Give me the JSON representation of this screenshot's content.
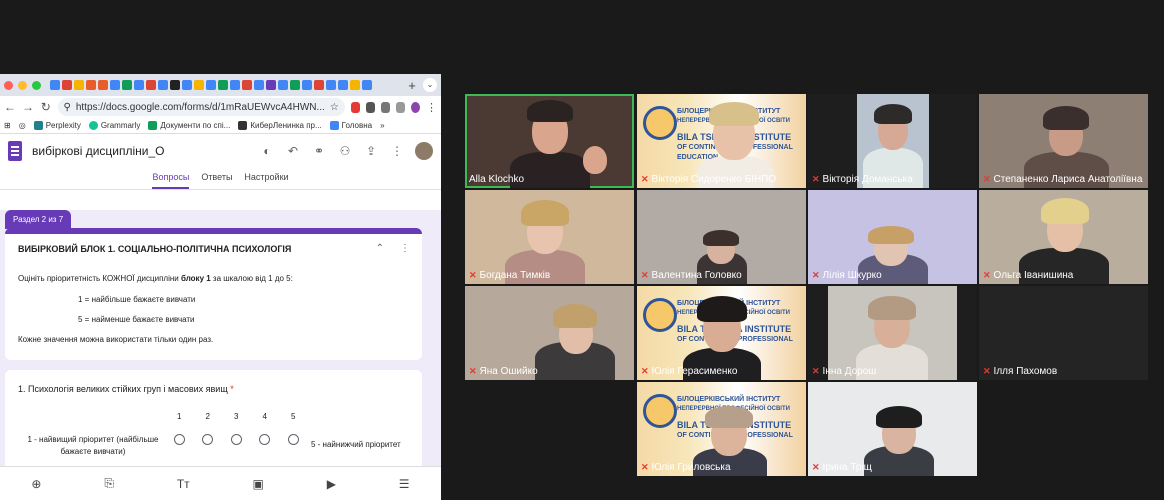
{
  "browser": {
    "url": "https://docs.google.com/forms/d/1mRaUEWvcA4HWN...",
    "bookmarks": [
      "Perplexity",
      "Grammarly",
      "Документи по спі...",
      "КиберЛенинка пр...",
      "Головна"
    ],
    "bookmarks_more": "»"
  },
  "forms": {
    "doc_title": "вибіркові дисципліни_О",
    "tabs": [
      "Вопросы",
      "Ответы",
      "Настройки"
    ],
    "section_tag": "Раздел 2 из 7",
    "section_title": "ВИБІРКОВИЙ БЛОК 1. СОЦІАЛЬНО-ПОЛІТИЧНА ПСИХОЛОГІЯ",
    "desc_pre": "Оцініть пріоритетність КОЖНОЇ дисципліни ",
    "desc_bold": "блоку 1",
    "desc_post": " за шкалою від 1 до 5:",
    "scale_best": "1 = найбільше бажаєте вивчати",
    "scale_worst": "5 = найменше бажаєте вивчати",
    "note": "Кожне значення можна використати тільки один раз.",
    "question_title": "1. Психологія великих стійких груп і масових явищ",
    "required_mark": "*",
    "scale_numbers": [
      "1",
      "2",
      "3",
      "4",
      "5"
    ],
    "scale_low_label": "1 - найвищий пріоритет (найбільше бажаєте вивчати)",
    "scale_high_label": "5 - найнижчий пріоритет"
  },
  "participants": [
    {
      "name": "Alla Klochko",
      "muted": false,
      "active": true
    },
    {
      "name": "Вікторія Сидоренко БІНПО",
      "muted": true,
      "active": false
    },
    {
      "name": "Вікторія Доманська",
      "muted": true,
      "active": false
    },
    {
      "name": "Степаненко Лариса Анатоліївна",
      "muted": true,
      "active": false
    },
    {
      "name": "Богдана Тимків",
      "muted": true,
      "active": false
    },
    {
      "name": "Валентина Головко",
      "muted": true,
      "active": false
    },
    {
      "name": "Лілія Шкурко",
      "muted": true,
      "active": false
    },
    {
      "name": "Ольга Іванишина",
      "muted": true,
      "active": false
    },
    {
      "name": "Яна Ошийко",
      "muted": true,
      "active": false
    },
    {
      "name": "Юлія Герасименко",
      "muted": true,
      "active": false
    },
    {
      "name": "Інна Дорош",
      "muted": true,
      "active": false
    },
    {
      "name": "Ілля Пахомов",
      "muted": true,
      "active": false
    },
    {
      "name": "Юлія Гриловська",
      "muted": true,
      "active": false
    },
    {
      "name": "Ірина Тріщ",
      "muted": true,
      "active": false
    }
  ],
  "poster": {
    "line1": "БІЛОЦЕРКІВСЬКИЙ ІНСТИТУТ",
    "line2": "НЕПЕРЕРВНОЇ ПРОФЕСІЙНОЇ ОСВІТИ",
    "line3": "BILA TSERKVA INSTITUTE",
    "line4": "OF CONTINUOUS PROFESSIONAL",
    "line5": "EDUCATION"
  }
}
